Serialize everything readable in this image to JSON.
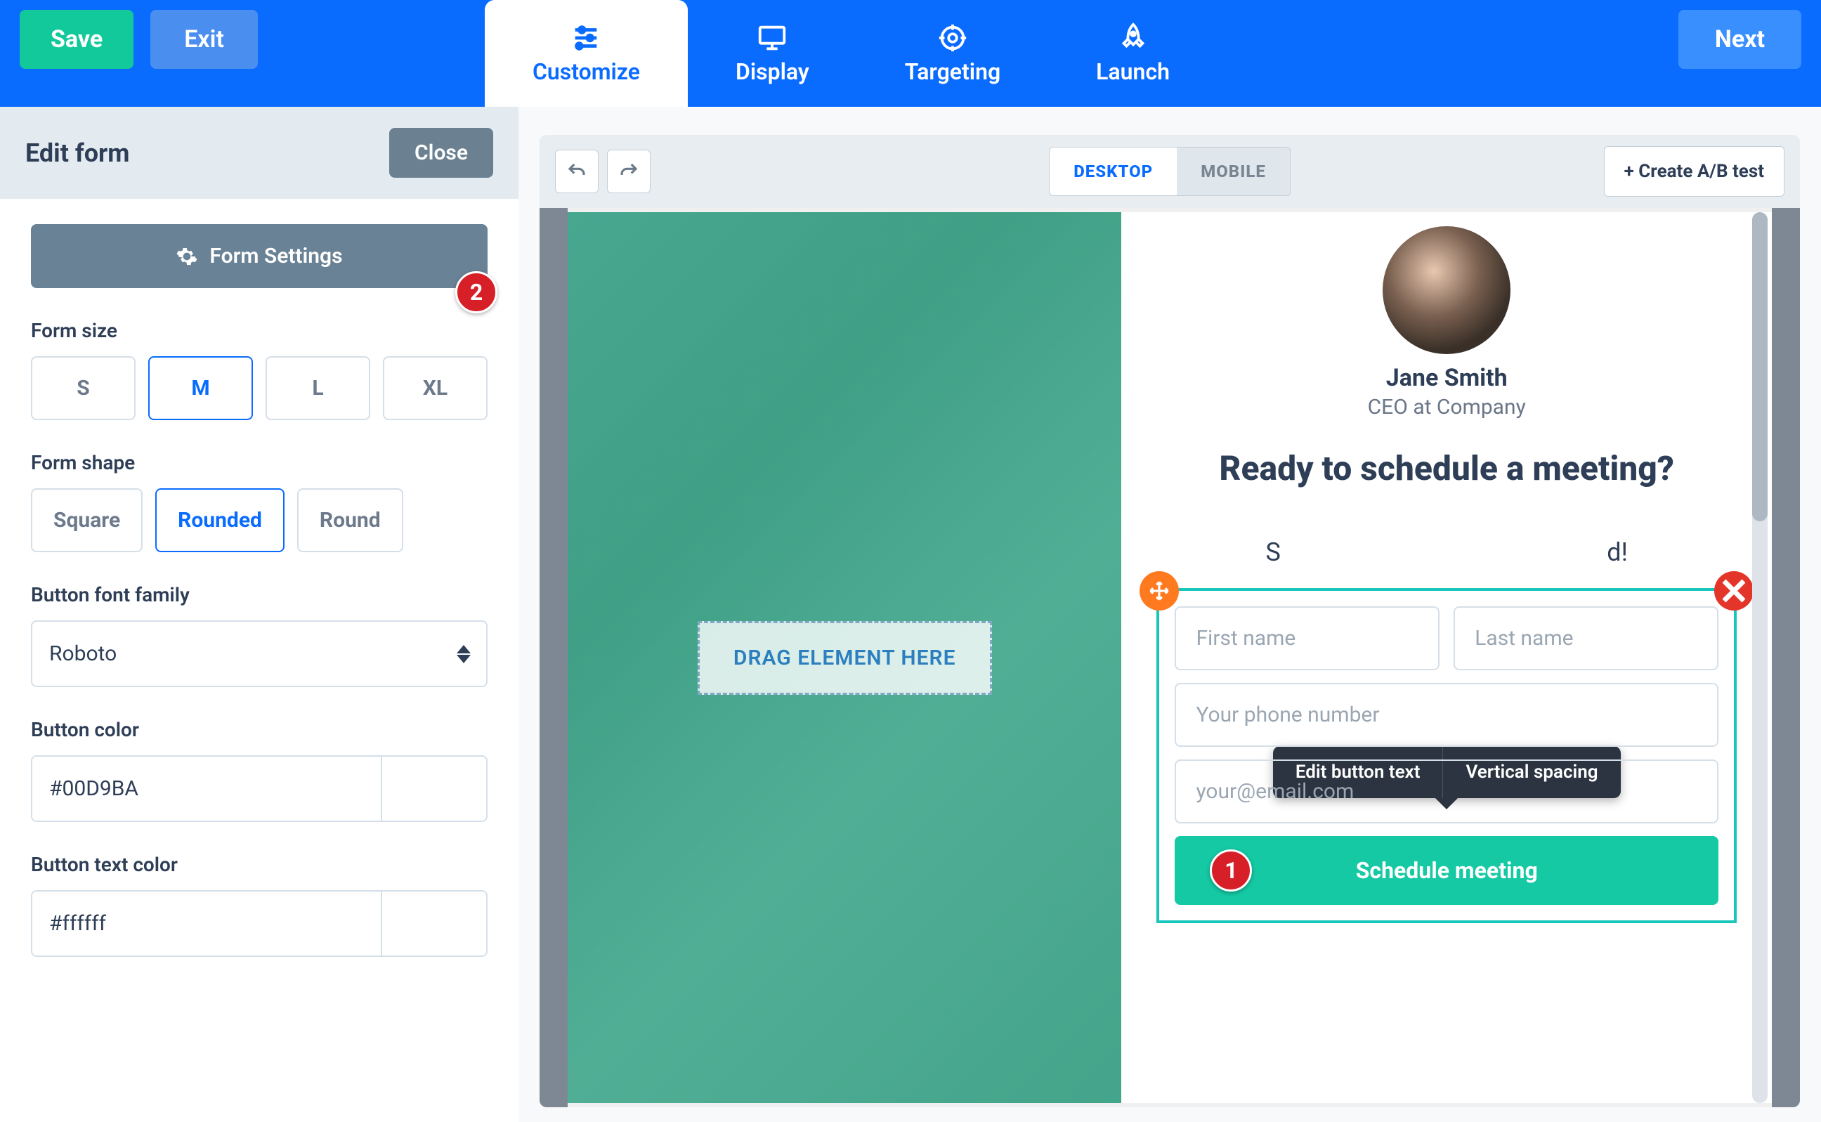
{
  "topbar": {
    "save": "Save",
    "exit": "Exit",
    "next": "Next",
    "tabs": {
      "customize": "Customize",
      "display": "Display",
      "targeting": "Targeting",
      "launch": "Launch"
    }
  },
  "sidebar": {
    "title": "Edit form",
    "close": "Close",
    "form_settings": "Form Settings",
    "badge2": "2",
    "form_size_label": "Form size",
    "sizes": {
      "s": "S",
      "m": "M",
      "l": "L",
      "xl": "XL"
    },
    "form_shape_label": "Form shape",
    "shapes": {
      "square": "Square",
      "rounded": "Rounded",
      "round": "Round"
    },
    "font_label": "Button font family",
    "font_value": "Roboto",
    "btn_color_label": "Button color",
    "btn_color_value": "#00D9BA",
    "btn_text_color_label": "Button text color",
    "btn_text_color_value": "#ffffff"
  },
  "canvas": {
    "desktop": "DESKTOP",
    "mobile": "MOBILE",
    "ab_test": "+ Create A/B test",
    "drop": "DRAG ELEMENT HERE",
    "person_name": "Jane Smith",
    "person_title": "CEO at Company",
    "heading": "Ready to schedule a meeting?",
    "sub_prefix": "S",
    "sub_suffix": "d!",
    "tooltip_edit": "Edit button text",
    "tooltip_spacing": "Vertical spacing",
    "form": {
      "first": "First name",
      "last": "Last name",
      "phone": "Your phone number",
      "email": "your@email.com",
      "submit": "Schedule meeting",
      "badge1": "1"
    }
  },
  "colors": {
    "accent": "#00D9BA"
  }
}
